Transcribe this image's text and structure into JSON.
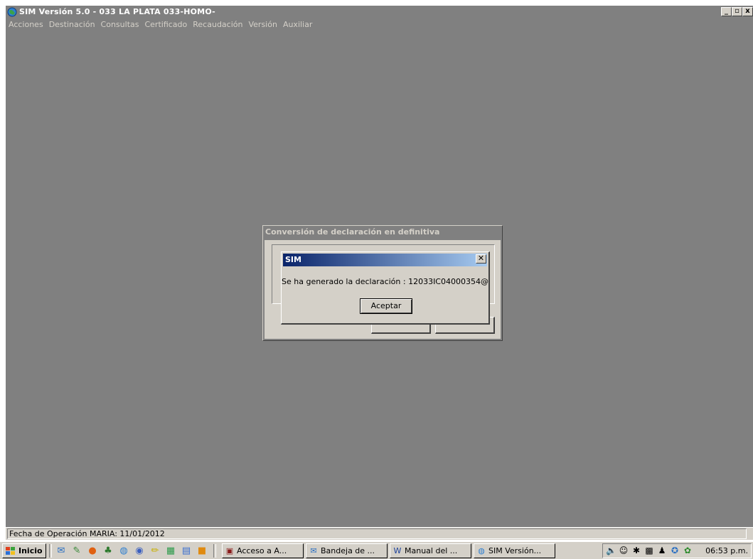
{
  "window": {
    "title": "SIM Versión 5.0 - 033 LA PLATA 033-HOMO-",
    "minimize": "_",
    "maximize": "▫",
    "close": "x"
  },
  "menu": [
    "Acciones",
    "Destinación",
    "Consultas",
    "Certificado",
    "Recaudación",
    "Versión",
    "Auxiliar"
  ],
  "status": {
    "text": "Fecha de Operación MARIA: 11/01/2012"
  },
  "conversion_dialog": {
    "title": "Conversión de declaración en definitiva"
  },
  "message_box": {
    "title": "SIM",
    "close": "✕",
    "message": "Se ha generado la declaración  : 12033IC04000354@",
    "ok_button": "Aceptar"
  },
  "taskbar": {
    "start": "Inicio",
    "quick_launch_icons": [
      "outlook-icon",
      "edit-icon",
      "firefox-icon",
      "tree-icon",
      "globe-icon",
      "chrome-icon",
      "pencil-icon",
      "grid-icon",
      "notepad-icon",
      "app-icon"
    ],
    "tasks": [
      {
        "label": "Acceso a A...",
        "icon": "access-icon"
      },
      {
        "label": "Bandeja de ...",
        "icon": "outlook-icon"
      },
      {
        "label": "Manual del ...",
        "icon": "word-icon"
      },
      {
        "label": "SIM Versión...",
        "icon": "sim-icon"
      }
    ],
    "clock": "06:53 p.m."
  },
  "colors": {
    "desktop": "#808080",
    "face": "#d4d0c8",
    "active_title_start": "#0a246a",
    "active_title_end": "#a6caf0"
  }
}
